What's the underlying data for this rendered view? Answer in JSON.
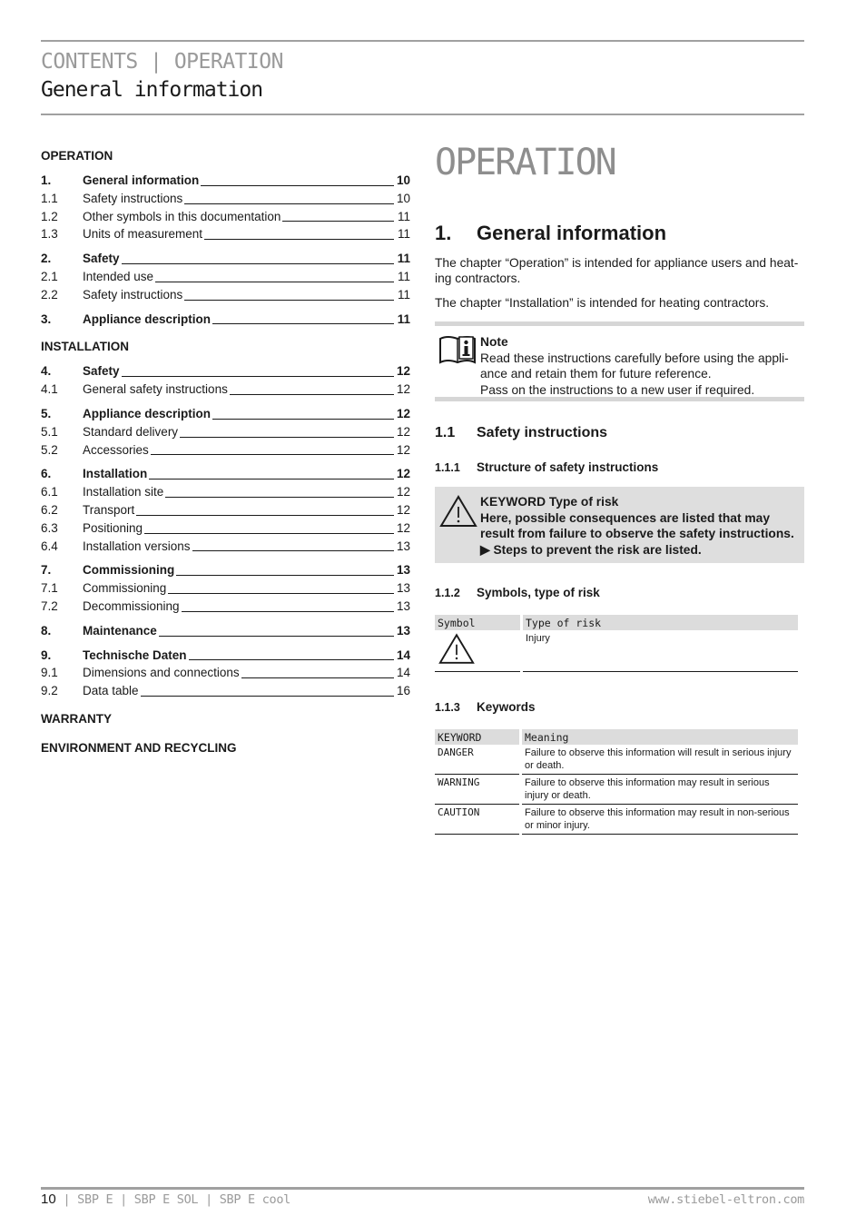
{
  "header": {
    "breadcrumb": "CONTENTS | OPERATION",
    "subtitle": "General information"
  },
  "toc": {
    "operation_label": "OPERATION",
    "operation": [
      {
        "num": "1.",
        "title": "General information",
        "page": "10",
        "main": true
      },
      {
        "num": "1.1",
        "title": "Safety instructions",
        "page": "10"
      },
      {
        "num": "1.2",
        "title": "Other symbols in this documentation",
        "page": "11"
      },
      {
        "num": "1.3",
        "title": "Units of measurement",
        "page": "11"
      },
      {
        "num": "2.",
        "title": "Safety",
        "page": "11",
        "main": true
      },
      {
        "num": "2.1",
        "title": "Intended use",
        "page": "11"
      },
      {
        "num": "2.2",
        "title": "Safety instructions",
        "page": "11"
      },
      {
        "num": "3.",
        "title": "Appliance description",
        "page": "11",
        "main": true
      }
    ],
    "installation_label": "INSTALLATION",
    "installation": [
      {
        "num": "4.",
        "title": "Safety",
        "page": "12",
        "main": true
      },
      {
        "num": "4.1",
        "title": "General safety instructions",
        "page": "12"
      },
      {
        "num": "5.",
        "title": "Appliance description",
        "page": "12",
        "main": true
      },
      {
        "num": "5.1",
        "title": "Standard delivery",
        "page": "12"
      },
      {
        "num": "5.2",
        "title": "Accessories",
        "page": "12"
      },
      {
        "num": "6.",
        "title": "Installation",
        "page": "12",
        "main": true
      },
      {
        "num": "6.1",
        "title": "Installation site",
        "page": "12"
      },
      {
        "num": "6.2",
        "title": "Transport",
        "page": "12"
      },
      {
        "num": "6.3",
        "title": "Positioning",
        "page": "12"
      },
      {
        "num": "6.4",
        "title": "Installation versions",
        "page": "13"
      },
      {
        "num": "7.",
        "title": "Commissioning",
        "page": "13",
        "main": true
      },
      {
        "num": "7.1",
        "title": "Commissioning",
        "page": "13"
      },
      {
        "num": "7.2",
        "title": "Decommissioning",
        "page": "13"
      },
      {
        "num": "8.",
        "title": "Maintenance",
        "page": "13",
        "main": true
      },
      {
        "num": "9.",
        "title": "Technische Daten",
        "page": "14",
        "main": true
      },
      {
        "num": "9.1",
        "title": "Dimensions and connections",
        "page": "14"
      },
      {
        "num": "9.2",
        "title": "Data table",
        "page": "16"
      }
    ],
    "warranty_label": "WARRANTY",
    "environment_label": "ENVIRONMENT AND RECYCLING"
  },
  "main": {
    "big_title": "OPERATION",
    "h1_num": "1.",
    "h1_title": "General information",
    "para1": "The chapter “Operation” is intended for appliance users and heat-ing contractors.",
    "para2": "The chapter “Installation” is intended for heating contractors.",
    "note": {
      "icon": "manual-info-icon",
      "title": "Note",
      "line1": "Read these instructions carefully before using the appli-ance and retain them for future reference.",
      "line2": "Pass on the instructions to a new user if required."
    },
    "s11_num": "1.1",
    "s11_title": "Safety instructions",
    "s111_num": "1.1.1",
    "s111_title": "Structure of safety instructions",
    "safety_box": {
      "icon": "warning-triangle-icon",
      "keyword_line": "KEYWORD Type of risk",
      "consequences": "Here, possible consequences are listed that may result from failure to observe the safety instructions.",
      "step": "Steps to prevent the risk are listed."
    },
    "s112_num": "1.1.2",
    "s112_title": "Symbols, type of risk",
    "symbols_table": {
      "headers": [
        "Symbol",
        "Type of risk"
      ],
      "rows": [
        {
          "symbol": "warning-triangle-icon",
          "risk": "Injury"
        }
      ]
    },
    "s113_num": "1.1.3",
    "s113_title": "Keywords",
    "keywords_table": {
      "headers": [
        "KEYWORD",
        "Meaning"
      ],
      "rows": [
        {
          "keyword": "DANGER",
          "meaning": "Failure to observe this information will result in serious injury or death."
        },
        {
          "keyword": "WARNING",
          "meaning": "Failure to observe this information may result in serious injury or death."
        },
        {
          "keyword": "CAUTION",
          "meaning": "Failure to observe this information may result in non-serious or minor injury."
        }
      ]
    }
  },
  "footer": {
    "page_number": "10",
    "models": " | SBP E | SBP E SOL | SBP E cool",
    "website": "www.stiebel-eltron.com"
  }
}
